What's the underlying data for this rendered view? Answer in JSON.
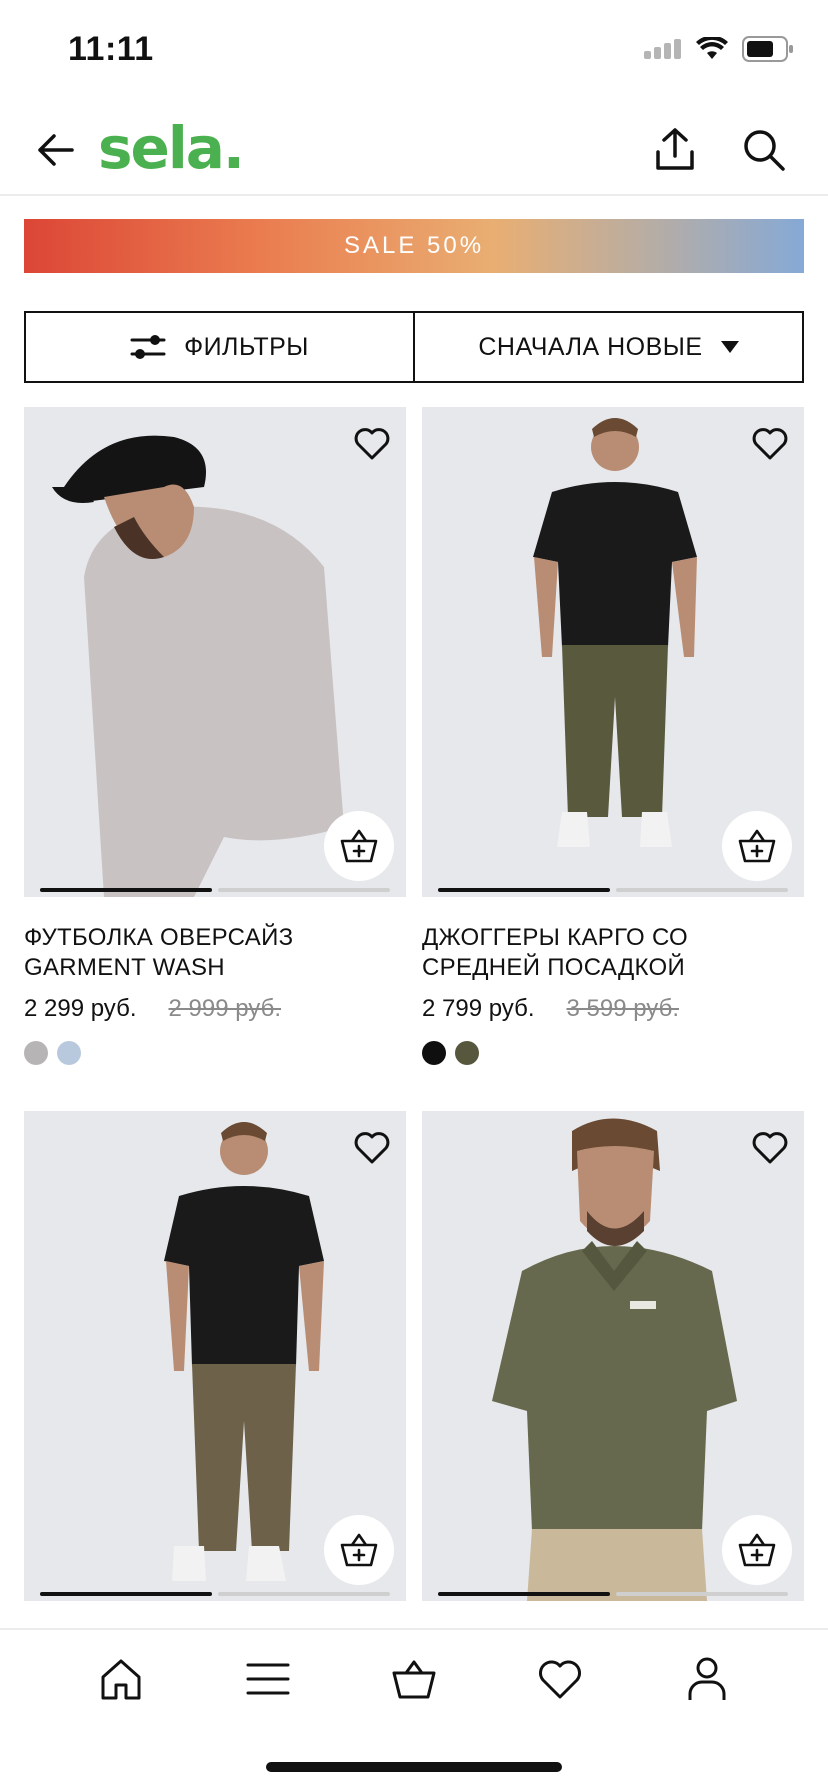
{
  "status_bar": {
    "time": "11:11"
  },
  "header": {
    "logo": "sela.",
    "back_icon": "arrow-left-icon",
    "share_icon": "share-icon",
    "search_icon": "search-icon"
  },
  "sale_banner": {
    "text": "SALE 50%"
  },
  "filter_bar": {
    "filters_label": "ФИЛЬТРЫ",
    "sort_label": "СНАЧАЛА НОВЫЕ"
  },
  "products": [
    {
      "name": "ФУТБОЛКА ОВЕРСАЙЗ GARMENT WASH",
      "price": "2 299 руб.",
      "old_price": "2 999 руб.",
      "swatches": [
        "#b7b4b6",
        "#b9c9dd"
      ]
    },
    {
      "name": "ДЖОГГЕРЫ КАРГО СО СРЕДНЕЙ ПОСАДКОЙ",
      "price": "2 799 руб.",
      "old_price": "3 599 руб.",
      "swatches": [
        "#0f0f0f",
        "#56573c"
      ]
    },
    {
      "name": "",
      "price": "",
      "old_price": "",
      "swatches": []
    },
    {
      "name": "",
      "price": "",
      "old_price": "",
      "swatches": []
    }
  ],
  "bottom_nav": {
    "items": [
      "home-icon",
      "menu-icon",
      "basket-icon",
      "heart-icon",
      "profile-icon"
    ]
  },
  "colors": {
    "brand_green": "#4bb04f",
    "text": "#111111",
    "muted": "#8a8a8a"
  }
}
